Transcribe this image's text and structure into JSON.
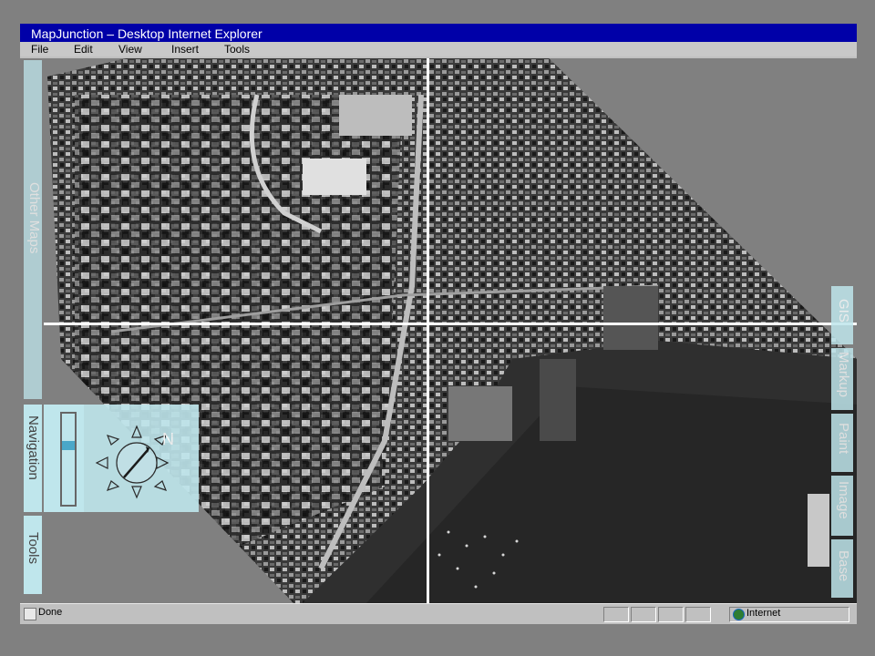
{
  "window": {
    "title": "MapJunction – Desktop  Internet Explorer"
  },
  "menu": {
    "items": [
      "File",
      "Edit",
      "View",
      "Insert",
      "Tools"
    ]
  },
  "left_tabs": {
    "other_maps": "Other Maps",
    "navigation": "Navigation",
    "tools": "Tools"
  },
  "compass": {
    "north_label": "N"
  },
  "right_tabs": {
    "items": [
      "GIS",
      "Markup",
      "Paint",
      "Image",
      "Base"
    ]
  },
  "status": {
    "text": "Done",
    "zone": "Internet"
  },
  "colors": {
    "titlebar": "#0000a8",
    "panel": "#bfe6ec",
    "arrow": "#1e90ff"
  }
}
